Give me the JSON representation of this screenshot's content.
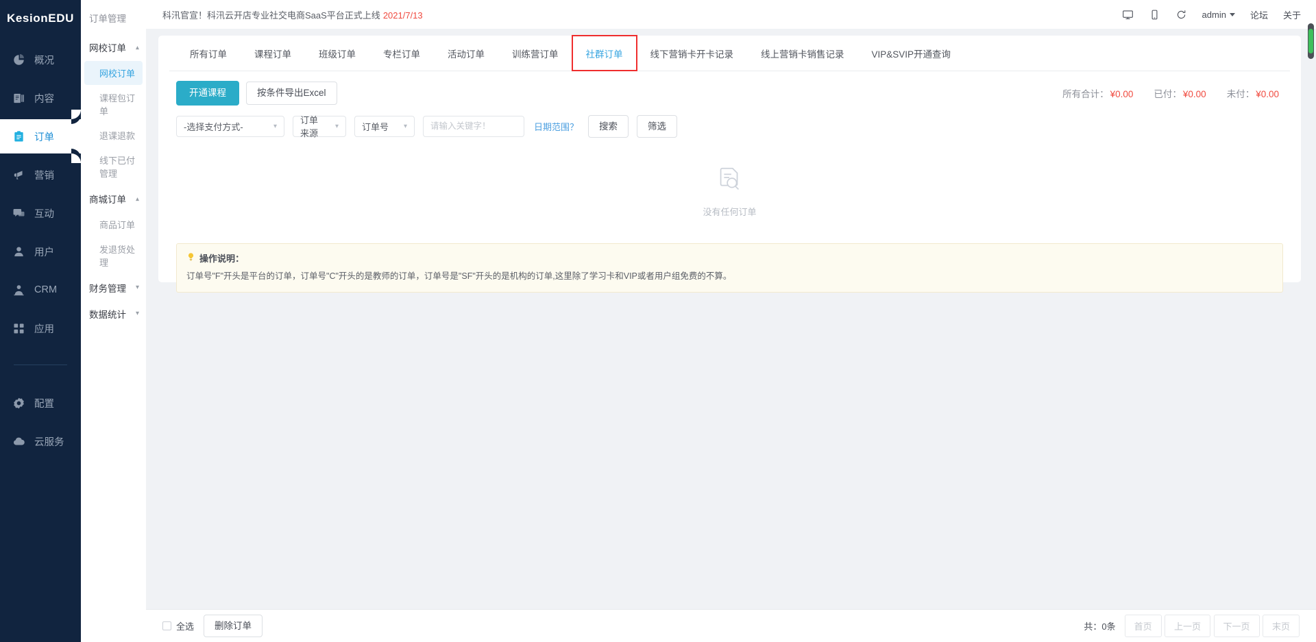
{
  "brand": {
    "name": "KesionEDU"
  },
  "rail": {
    "items": [
      {
        "label": "概况",
        "icon": "chart-pie-icon",
        "active": false
      },
      {
        "label": "内容",
        "icon": "content-list-icon",
        "active": false
      },
      {
        "label": "订单",
        "icon": "order-clipboard-icon",
        "active": true
      },
      {
        "label": "营销",
        "icon": "megaphone-icon",
        "active": false
      },
      {
        "label": "互动",
        "icon": "chat-bubble-icon",
        "active": false
      },
      {
        "label": "用户",
        "icon": "user-icon",
        "active": false
      },
      {
        "label": "CRM",
        "icon": "crm-user-icon",
        "active": false
      },
      {
        "label": "应用",
        "icon": "apps-grid-icon",
        "active": false
      }
    ],
    "bottom_items": [
      {
        "label": "配置",
        "icon": "gear-icon",
        "active": false
      },
      {
        "label": "云服务",
        "icon": "cloud-icon",
        "active": false
      }
    ]
  },
  "submenu": {
    "title": "订单管理",
    "groups": [
      {
        "label": "网校订单",
        "expanded": true,
        "items": [
          {
            "label": "网校订单",
            "active": true
          },
          {
            "label": "课程包订单",
            "active": false
          },
          {
            "label": "退课退款",
            "active": false
          },
          {
            "label": "线下已付管理",
            "active": false
          }
        ]
      },
      {
        "label": "商城订单",
        "expanded": true,
        "items": [
          {
            "label": "商品订单",
            "active": false
          },
          {
            "label": "发退货处理",
            "active": false
          }
        ]
      },
      {
        "label": "财务管理",
        "expanded": false,
        "items": []
      },
      {
        "label": "数据统计",
        "expanded": false,
        "items": []
      }
    ]
  },
  "topbar": {
    "announcement": "科汛官宣！科汛云开店专业社交电商SaaS平台正式上线",
    "announcement_date": "2021/7/13",
    "icons": [
      {
        "name": "desktop-icon"
      },
      {
        "name": "mobile-icon"
      },
      {
        "name": "refresh-icon"
      }
    ],
    "user": "admin",
    "links": [
      "论坛",
      "关于"
    ]
  },
  "tabs": [
    {
      "label": "所有订单",
      "active": false,
      "highlight": false
    },
    {
      "label": "课程订单",
      "active": false,
      "highlight": false
    },
    {
      "label": "班级订单",
      "active": false,
      "highlight": false
    },
    {
      "label": "专栏订单",
      "active": false,
      "highlight": false
    },
    {
      "label": "活动订单",
      "active": false,
      "highlight": false
    },
    {
      "label": "训练营订单",
      "active": false,
      "highlight": false
    },
    {
      "label": "社群订单",
      "active": true,
      "highlight": true
    },
    {
      "label": "线下营销卡开卡记录",
      "active": false,
      "highlight": false
    },
    {
      "label": "线上营销卡销售记录",
      "active": false,
      "highlight": false
    },
    {
      "label": "VIP&SVIP开通查询",
      "active": false,
      "highlight": false
    }
  ],
  "toolbar": {
    "open_course_label": "开通课程",
    "export_excel_label": "按条件导出Excel",
    "totals": [
      {
        "label": "所有合计：",
        "amount": "¥0.00"
      },
      {
        "label": "已付：",
        "amount": "¥0.00"
      },
      {
        "label": "未付：",
        "amount": "¥0.00"
      }
    ]
  },
  "filters": {
    "pay_method": "-选择支付方式-",
    "order_source": "订单来源",
    "order_no": "订单号",
    "keyword_value": "",
    "keyword_placeholder": "请输入关键字！",
    "date_range_label": "日期范围？",
    "search_label": "搜索",
    "filter_label": "筛选"
  },
  "empty": {
    "icon": "document-search-icon",
    "label": "没有任何订单"
  },
  "infobox": {
    "icon": "lightbulb-icon",
    "title": "操作说明：",
    "body": "订单号\"F\"开头是平台的订单，订单号\"C\"开头的是教师的订单，订单号是\"SF\"开头的是机构的订单,这里除了学习卡和VIP或者用户组免费的不算。"
  },
  "footer": {
    "select_all_label": "全选",
    "delete_order_label": "删除订单",
    "count_text": "共：0条",
    "pagination": [
      "首页",
      "上一页",
      "下一页",
      "末页"
    ]
  },
  "colors": {
    "rail_bg": "#11243f",
    "accent_blue": "#36a4e0",
    "primary_teal": "#2bacc8",
    "danger_red": "#f04a3f",
    "highlight_red": "#ef2d2d",
    "scrollbar_green": "#3fbf5c"
  }
}
